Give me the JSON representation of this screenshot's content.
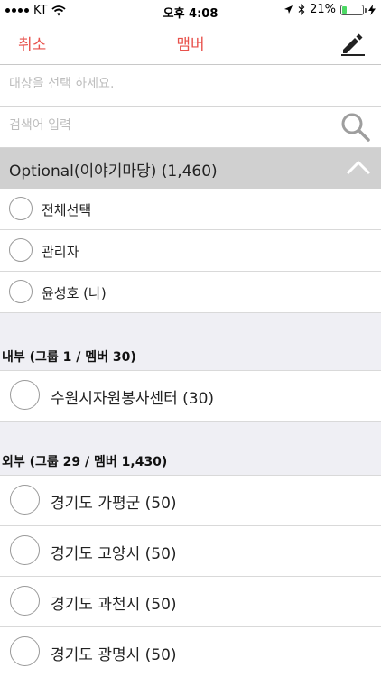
{
  "status_bar": {
    "carrier": "KT",
    "time": "오후 4:08",
    "battery_percent": "21%",
    "battery_level": 0.21,
    "battery_color": "#4cd964"
  },
  "nav": {
    "cancel_label": "취소",
    "title": "맴버",
    "edit_icon": "pencil-icon",
    "accent_color": "#e8514b"
  },
  "target_input": {
    "placeholder": "대상을 선택 하세요.",
    "value": ""
  },
  "search": {
    "placeholder": "검색어 입력",
    "value": "",
    "icon": "search-icon"
  },
  "group": {
    "label": "Optional(이야기마당) (1,460)",
    "icon": "chevron-up-icon"
  },
  "top_items": [
    {
      "label": "전체선택"
    },
    {
      "label": "관리자"
    },
    {
      "label": "윤성호 (나)"
    }
  ],
  "internal_section": {
    "title": "내부 (그룹 1 / 멤버 30)",
    "items": [
      {
        "label": "수원시자원봉사센터 (30)"
      }
    ]
  },
  "external_section": {
    "title": "외부 (그룹 29 / 멤버 1,430)",
    "items": [
      {
        "label": "경기도 가평군 (50)"
      },
      {
        "label": "경기도 고양시 (50)"
      },
      {
        "label": "경기도 과천시 (50)"
      },
      {
        "label": "경기도 광명시 (50)"
      }
    ]
  }
}
